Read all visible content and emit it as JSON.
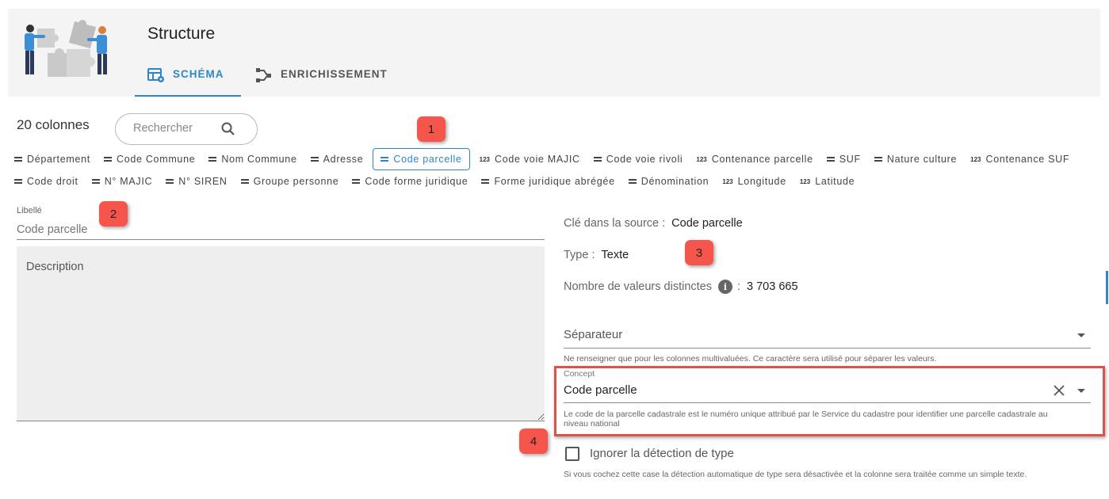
{
  "header": {
    "title": "Structure",
    "tabs": [
      {
        "label": "SCHÉMA",
        "icon": "table-settings-icon",
        "active": true
      },
      {
        "label": "ENRICHISSEMENT",
        "icon": "graph-branch-icon",
        "active": false
      }
    ]
  },
  "toolbar": {
    "count_label": "20 colonnes",
    "search_placeholder": "Rechercher"
  },
  "markers": [
    "1",
    "2",
    "3",
    "4"
  ],
  "columns": {
    "row1": [
      {
        "label": "Département",
        "type": "text"
      },
      {
        "label": "Code Commune",
        "type": "text"
      },
      {
        "label": "Nom Commune",
        "type": "text"
      },
      {
        "label": "Adresse",
        "type": "text"
      },
      {
        "label": "Code parcelle",
        "type": "text",
        "selected": true
      },
      {
        "label": "Code voie MAJIC",
        "type": "number"
      },
      {
        "label": "Code voie rivoli",
        "type": "text"
      },
      {
        "label": "Contenance parcelle",
        "type": "number"
      },
      {
        "label": "SUF",
        "type": "text"
      },
      {
        "label": "Nature culture",
        "type": "text"
      },
      {
        "label": "Contenance SUF",
        "type": "number"
      }
    ],
    "row2": [
      {
        "label": "Code droit",
        "type": "text"
      },
      {
        "label": "N° MAJIC",
        "type": "text"
      },
      {
        "label": "N° SIREN",
        "type": "text"
      },
      {
        "label": "Groupe personne",
        "type": "text"
      },
      {
        "label": "Code forme juridique",
        "type": "text"
      },
      {
        "label": "Forme juridique abrégée",
        "type": "text"
      },
      {
        "label": "Dénomination",
        "type": "text"
      },
      {
        "label": "Longitude",
        "type": "number"
      },
      {
        "label": "Latitude",
        "type": "number"
      }
    ],
    "number_icon_text": "123"
  },
  "form": {
    "libelle_label": "Libellé",
    "libelle_placeholder": "Code parcelle",
    "description_placeholder": "Description"
  },
  "details": {
    "source_key_label": "Clé dans la source :",
    "source_key_value": "Code parcelle",
    "type_label": "Type :",
    "type_value": "Texte",
    "distinct_label": "Nombre de valeurs distinctes",
    "distinct_sep": ":",
    "distinct_value": "3 703 665",
    "info_icon_text": "i",
    "separator_label": "Séparateur",
    "separator_hint": "Ne renseigner que pour les colonnes multivaluées. Ce caractère sera utilisé pour séparer les valeurs.",
    "concept_label": "Concept",
    "concept_value": "Code parcelle",
    "concept_hint": "Le code de la parcelle cadastrale est le numéro unique attribué par le Service du cadastre pour identifier une parcelle cadastrale au niveau national",
    "ignore_label": "Ignorer la détection de type",
    "ignore_checked": false,
    "ignore_hint": "Si vous cochez cette case la détection automatique de type sera désactivée et la colonne sera traitée comme un simple texte."
  },
  "colors": {
    "accent": "#2f86c7",
    "marker": "#f5554a",
    "highlight_border": "#d9534f"
  }
}
